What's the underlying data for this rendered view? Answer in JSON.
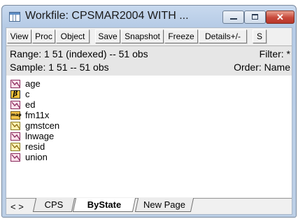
{
  "window": {
    "title": "Workfile: CPSMAR2004 WITH ...",
    "close_glyph": "✕"
  },
  "toolbar": {
    "buttons": [
      "View",
      "Proc",
      "Object",
      "Save",
      "Snapshot",
      "Freeze",
      "Details+/-",
      "S"
    ]
  },
  "info": {
    "range": "Range:  1 51 (indexed)  --  51 obs",
    "filter": "Filter: *",
    "sample": "Sample: 1 51  --  51 obs",
    "order": "Order: Name"
  },
  "objects": [
    {
      "label": "age",
      "icon": "series-icon"
    },
    {
      "label": "c",
      "icon": "coefficient-vector-icon"
    },
    {
      "label": "ed",
      "icon": "series-icon"
    },
    {
      "label": "fm11x",
      "icon": "map-icon"
    },
    {
      "label": "gmstcen",
      "icon": "generated-series-icon"
    },
    {
      "label": "lnwage",
      "icon": "series-icon"
    },
    {
      "label": "resid",
      "icon": "residual-series-icon"
    },
    {
      "label": "union",
      "icon": "series-icon"
    }
  ],
  "icon_text": {
    "coef": "β",
    "map": "map"
  },
  "tabs": {
    "nav": "< >",
    "items": [
      "CPS",
      "ByState",
      "New Page"
    ],
    "active": "ByState"
  }
}
